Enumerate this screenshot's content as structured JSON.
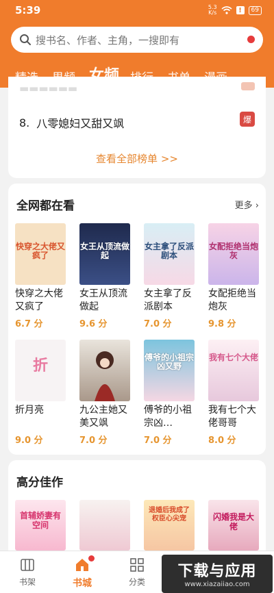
{
  "status": {
    "time": "5:39",
    "speed_top": "5.3",
    "speed_bot": "K/s",
    "alert": "!",
    "battery": "69"
  },
  "search": {
    "placeholder": "搜书名、作者、主角，一搜即有"
  },
  "tabs": [
    "精选",
    "男频",
    "女频",
    "排行",
    "书单",
    "漫画"
  ],
  "ranking": {
    "number": "8.",
    "title": "八零媳妇又甜又飒",
    "badge": "爆",
    "view_all": "查看全部榜单 >>"
  },
  "section1": {
    "title": "全网都在看",
    "more": "更多",
    "books": [
      {
        "name": "快穿之大佬又疯了",
        "score": "6.7 分",
        "cover_title": "快穿之大佬又疯了",
        "bg": "#f6e1c3",
        "fg": "#d8552e"
      },
      {
        "name": "女王从顶流做起",
        "score": "9.6 分",
        "cover_title": "女王从顶流做起",
        "bg": "#2c3a66",
        "fg": "#ffffff"
      },
      {
        "name": "女主拿了反派剧本",
        "score": "7.0 分",
        "cover_title": "女主拿了反派剧本",
        "bg": "#cfe7ef",
        "fg": "#2a4d7a"
      },
      {
        "name": "女配拒绝当炮灰",
        "score": "9.8 分",
        "cover_title": "女配拒绝当炮灰",
        "bg": "#f2c9df",
        "fg": "#b0306e"
      },
      {
        "name": "折月亮",
        "score": "9.0 分",
        "cover_title": "折",
        "bg": "#f7f3f4",
        "fg": "#e87aa0"
      },
      {
        "name": "九公主她又美又飒",
        "score": "7.0 分",
        "cover_title": "",
        "bg": "#c9c0b5",
        "fg": "#7a2a1e"
      },
      {
        "name": "傅爷的小祖宗凶…",
        "score": "7.0 分",
        "cover_title": "傅爷的小祖宗凶又野",
        "bg": "#9ed2e6",
        "fg": "#ffffff"
      },
      {
        "name": "我有七个大佬哥哥",
        "score": "8.0 分",
        "cover_title": "我有七个大佬",
        "bg": "#fbe9ef",
        "fg": "#d5578a"
      }
    ]
  },
  "section2": {
    "title": "高分佳作",
    "covers": [
      {
        "bg": "#fbd0dc",
        "fg": "#d6336c",
        "text": "首辅娇妻有空间"
      },
      {
        "bg": "#f4f0ee",
        "fg": "#b54a5e",
        "text": ""
      },
      {
        "bg": "#fde3ad",
        "fg": "#d84c2a",
        "text": "退婚后我成了权臣心尖宠"
      },
      {
        "bg": "#f3d6de",
        "fg": "#c2185b",
        "text": "闪婚我是大佬"
      }
    ]
  },
  "nav": [
    {
      "label": "书架"
    },
    {
      "label": "书城"
    },
    {
      "label": "分类"
    }
  ],
  "watermark": {
    "main": "下载与应用",
    "sub": "www.xiazaiiao.com"
  },
  "colors": {
    "accent": "#f07c2c",
    "score": "#e6952f",
    "badge": "#d94a43"
  }
}
